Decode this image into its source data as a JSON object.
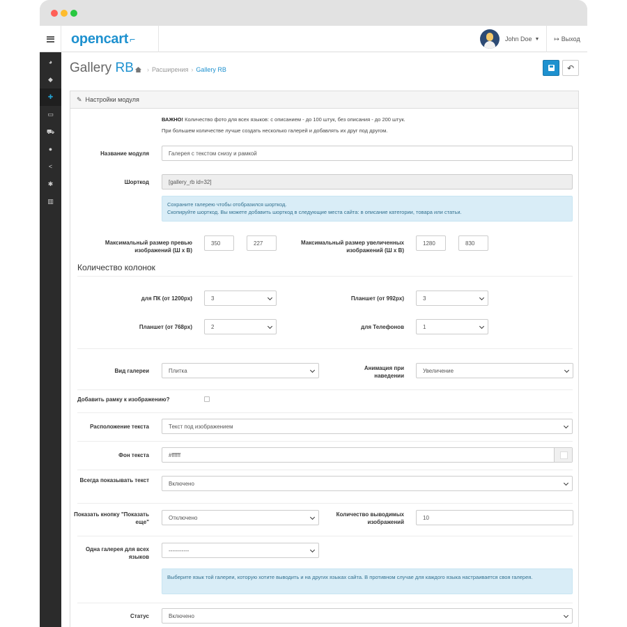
{
  "header": {
    "logo": "opencart",
    "user_name": "John Doe",
    "logout_label": "Выход"
  },
  "sidebar": {
    "icons": [
      "dashboard-icon",
      "tags-icon",
      "puzzle-icon",
      "desktop-icon",
      "cart-icon",
      "user-icon",
      "share-icon",
      "cog-icon",
      "bar-chart-icon"
    ],
    "active_index": 2
  },
  "page": {
    "title_main": "Gallery",
    "title_accent": "RB",
    "breadcrumb_ext": "Расширения",
    "breadcrumb_current": "Gallery RB"
  },
  "panel": {
    "heading": "Настройки модуля",
    "important_bold": "ВАЖНО!",
    "important_text": "Количество фото для всех языков: с описанием - до 100 штук, без описания - до 200 штук.",
    "important_text2": "При большем количестве лучше создать несколько галерей и добавлять их друг под другом."
  },
  "form": {
    "module_name_label": "Название модуля",
    "module_name_value": "Галерея с текстом снизу и рамкой",
    "shortcode_label": "Шорткод",
    "shortcode_value": "[gallery_rb id=32]",
    "shortcode_info_1": "Сохраните галерею чтобы отобразился шорткод.",
    "shortcode_info_2": "Скопируйте шорткод. Вы можете добавить шорткод в следующие места сайта: в описание категории, товара или статьи.",
    "thumb_label": "Максимальный размер превью изображений (Ш x В)",
    "thumb_w": "350",
    "thumb_h": "227",
    "large_label": "Максимальный размер увеличенных изображений (Ш x В)",
    "large_w": "1280",
    "large_h": "830",
    "columns_title": "Количество колонок",
    "pc_label": "для ПК (от 1200px)",
    "pc_value": "3",
    "tablet992_label": "Планшет (от 992px)",
    "tablet992_value": "3",
    "tablet768_label": "Планшет (от 768px)",
    "tablet768_value": "2",
    "phone_label": "для Телефонов",
    "phone_value": "1",
    "view_label": "Вид галереи",
    "view_value": "Плитка",
    "hover_label": "Анимация при наведении",
    "hover_value": "Увеличение",
    "frame_label": "Добавить рамку к изображению?",
    "text_pos_label": "Расположение текста",
    "text_pos_value": "Текст под изображением",
    "text_bg_label": "Фон текста",
    "text_bg_value": "#ffffff",
    "always_text_label": "Всегда показывать текст",
    "always_text_value": "Включено",
    "show_more_label": "Показать кнопку \"Показать еще\"",
    "show_more_value": "Отключено",
    "count_label": "Количество выводимых изображений",
    "count_value": "10",
    "one_gallery_label": "Одна галерея для всех языков",
    "one_gallery_value": "-----------",
    "one_gallery_info": "Выберите язык той галереи, которую хотите выводить и на других языках сайта. В противном случае для каждого языка настраивается своя галерея.",
    "status_label": "Статус",
    "status_value": "Включено"
  },
  "colors": {
    "accent": "#1e91cf",
    "sidebar": "#2b2b2b",
    "info_bg": "#d9edf7"
  }
}
